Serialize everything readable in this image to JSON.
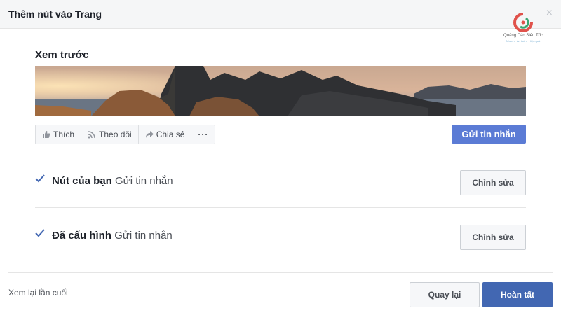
{
  "dialog": {
    "title": "Thêm nút vào Trang",
    "close": "×"
  },
  "logo": {
    "text": "Quảng Cáo Siêu Tốc",
    "sub": "Nhanh · An toàn · Hiệu quả",
    "colors": [
      "#e0524b",
      "#3aa772"
    ]
  },
  "preview": {
    "label": "Xem trước",
    "actions": [
      {
        "icon": "thumbs-up-icon",
        "label": "Thích"
      },
      {
        "icon": "rss-icon",
        "label": "Theo dõi"
      },
      {
        "icon": "share-arrow-icon",
        "label": "Chia sẻ"
      },
      {
        "icon": "more-dots-icon",
        "label": "···"
      }
    ],
    "message_button": "Gửi tin nhắn"
  },
  "rows": [
    {
      "bold": "Nút của bạn",
      "value": "Gửi tin nhắn",
      "edit": "Chỉnh sửa"
    },
    {
      "bold": "Đã cấu hình",
      "value": "Gửi tin nhắn",
      "edit": "Chỉnh sửa"
    }
  ],
  "footer": {
    "review_link": "Xem lại lần cuối",
    "back": "Quay lại",
    "done": "Hoàn tất"
  },
  "colors": {
    "primary": "#4267b2",
    "message_button": "#5b7bd5",
    "check": "#4267b2"
  }
}
